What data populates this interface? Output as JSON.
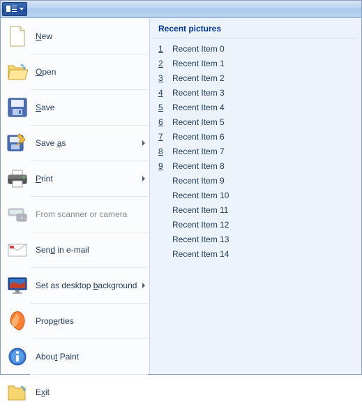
{
  "menu": {
    "new": "New",
    "open": "Open",
    "save": "Save",
    "saveas": "Save as",
    "print": "Print",
    "scanner": "From scanner or camera",
    "email": "Send in e-mail",
    "wallpaper": "Set as desktop background",
    "properties": "Properties",
    "about": "About Paint",
    "exit": "Exit"
  },
  "recent": {
    "title": "Recent pictures",
    "items": [
      {
        "num": "1",
        "label": "Recent Item 0"
      },
      {
        "num": "2",
        "label": "Recent Item 1"
      },
      {
        "num": "3",
        "label": "Recent Item 2"
      },
      {
        "num": "4",
        "label": "Recent Item 3"
      },
      {
        "num": "5",
        "label": "Recent Item 4"
      },
      {
        "num": "6",
        "label": "Recent Item 5"
      },
      {
        "num": "7",
        "label": "Recent Item 6"
      },
      {
        "num": "8",
        "label": "Recent Item 7"
      },
      {
        "num": "9",
        "label": "Recent Item 8"
      },
      {
        "num": "",
        "label": "Recent Item 9"
      },
      {
        "num": "",
        "label": "Recent Item 10"
      },
      {
        "num": "",
        "label": "Recent Item 11"
      },
      {
        "num": "",
        "label": "Recent Item 12"
      },
      {
        "num": "",
        "label": "Recent Item 13"
      },
      {
        "num": "",
        "label": "Recent Item 14"
      }
    ]
  }
}
